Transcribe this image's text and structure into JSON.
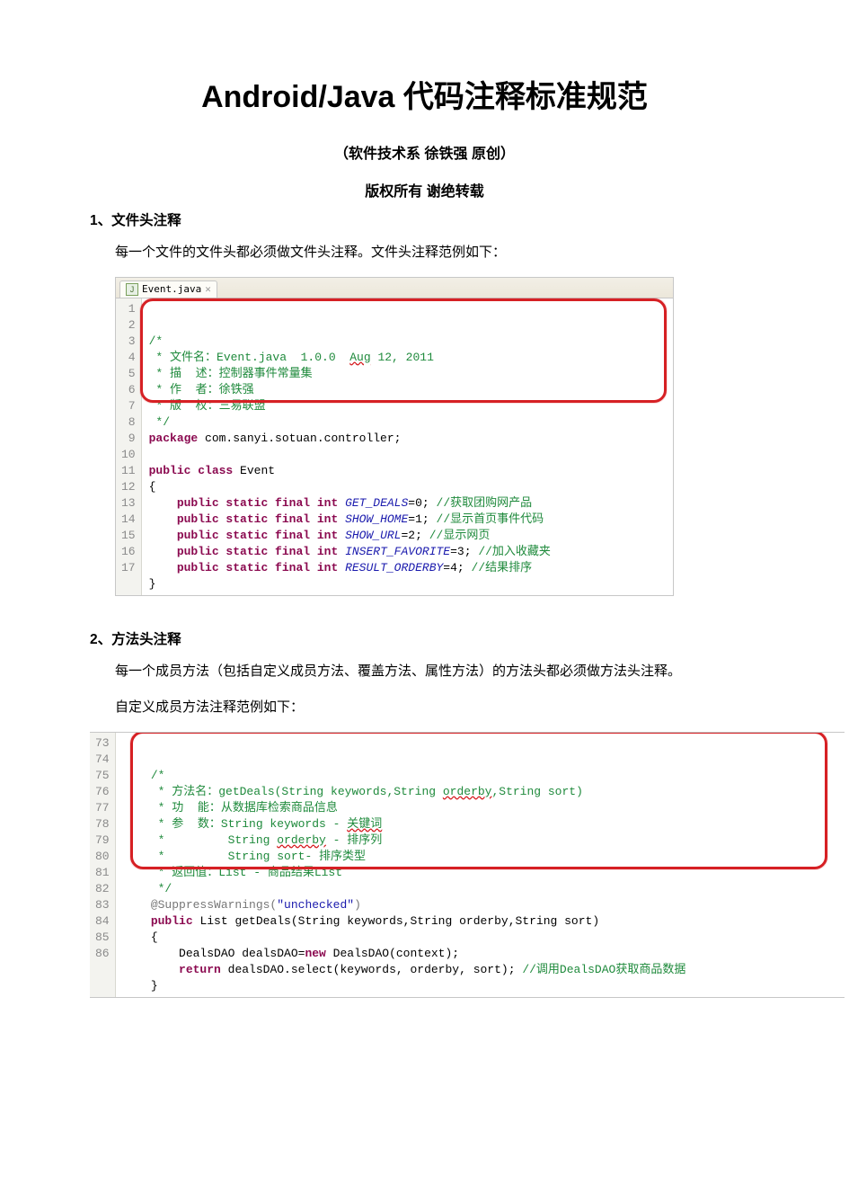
{
  "title": "Android/Java 代码注释标准规范",
  "subtitle": "（软件技术系  徐铁强  原创）",
  "copyright": "版权所有   谢绝转载",
  "section1": {
    "heading": "1、文件头注释",
    "desc": "每一个文件的文件头都必须做文件头注释。文件头注释范例如下：",
    "tab_filename": "Event.java",
    "gutter": " 1\n 2\n 3\n 4\n 5\n 6\n 7\n 8\n 9\n10\n11\n12\n13\n14\n15\n16\n17",
    "c1": "/*",
    "c2": " * 文件名：Event.java  1.0.0  ",
    "c2u": "Aug",
    "c2b": " 12, 2011",
    "c3": " * 描  述：控制器事件常量集",
    "c4": " * 作  者：徐铁强",
    "c5": " * 版  权：三易联盟",
    "c6": " */",
    "l7a": "package",
    "l7b": " com.sanyi.sotuan.controller;",
    "l9a": "public class",
    "l9b": " Event",
    "l10": "{",
    "l11a": "public static final int",
    "l11b": "GET_DEALS",
    "l11c": "=0; ",
    "l11d": "//获取团购网产品",
    "l12b": "SHOW_HOME",
    "l12c": "=1; ",
    "l12d": "//显示首页事件代码",
    "l13b": "SHOW_URL",
    "l13c": "=2; ",
    "l13d": "//显示网页",
    "l14b": "INSERT_FAVORITE",
    "l14c": "=3; ",
    "l14d": "//加入收藏夹",
    "l15b": "RESULT_ORDERBY",
    "l15c": "=4; ",
    "l15d": "//结果排序",
    "l16": "}"
  },
  "section2": {
    "heading": "2、方法头注释",
    "desc1": "每一个成员方法（包括自定义成员方法、覆盖方法、属性方法）的方法头都必须做方法头注释。",
    "desc2": "自定义成员方法注释范例如下：",
    "gutter": "73\n74\n75\n76\n77\n78\n79\n80\n81\n82\n83\n84\n85\n86",
    "c73": "    /*",
    "c74a": "     * 方法名：getDeals(String keywords,String ",
    "c74u": "orderby",
    "c74b": ",String sort)",
    "c75": "     * 功  能：从数据库检索商品信息",
    "c76a": "     * 参  数：String keywords - ",
    "c76u": "关键词",
    "c77a": "     *         String ",
    "c77u": "orderby",
    "c77b": " - 排序列",
    "c78": "     *         String sort- 排序类型",
    "c79": "     * 返回值：List - 商品结果List",
    "c80": "     */",
    "l81a": "    @SuppressWarnings(",
    "l81b": "\"unchecked\"",
    "l81c": ")",
    "l82a": "public",
    "l82b": " List getDeals(String keywords,String orderby,String sort)",
    "l83": "    {",
    "l84a": "        DealsDAO dealsDAO=",
    "l84kw": "new",
    "l84b": " DealsDAO(context);",
    "l85a": "return",
    "l85b": " dealsDAO.select(keywords, orderby, sort); ",
    "l85c": "//调用DealsDAO获取商品数据",
    "l86": "    }"
  }
}
